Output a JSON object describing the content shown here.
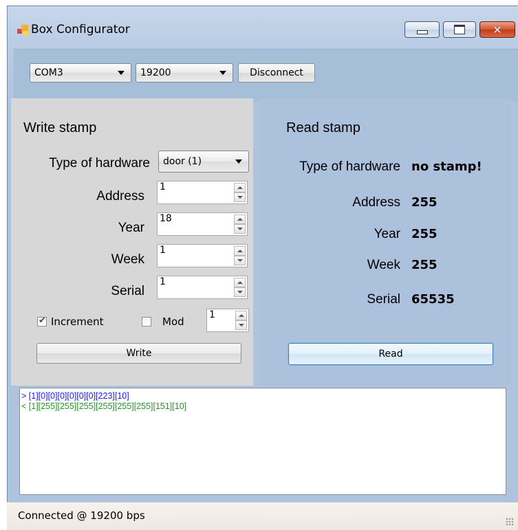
{
  "window": {
    "title": "Box Configurator"
  },
  "toolbar": {
    "port": "COM3",
    "baud": "19200",
    "disconnect_label": "Disconnect"
  },
  "write": {
    "title": "Write stamp",
    "hardware_label": "Type of hardware",
    "hardware_value": "door (1)",
    "address_label": "Address",
    "address_value": "1",
    "year_label": "Year",
    "year_value": "18",
    "week_label": "Week",
    "week_value": "1",
    "serial_label": "Serial",
    "serial_value": "1",
    "increment_label": "Increment",
    "increment_checked": true,
    "mod_label": "Mod",
    "mod_checked": false,
    "mod_value": "1",
    "write_button": "Write"
  },
  "read": {
    "title": "Read stamp",
    "hardware_label": "Type of hardware",
    "hardware_value": "no stamp!",
    "address_label": "Address",
    "address_value": "255",
    "year_label": "Year",
    "year_value": "255",
    "week_label": "Week",
    "week_value": "255",
    "serial_label": "Serial",
    "serial_value": "65535",
    "read_button": "Read"
  },
  "log": {
    "lines": [
      {
        "text": "> [1][0][0][0][0][0][0][223][10]",
        "color": "#1a1aff"
      },
      {
        "text": "< [1][255][255][255][255][255][255][151][10]",
        "color": "#1f9a1f"
      }
    ]
  },
  "status": {
    "text": "Connected @ 19200 bps"
  },
  "colors": {
    "write_panel": "#d7d7d7",
    "read_panel": "#abc1dc",
    "toolbar_panel": "#a6bfd9"
  }
}
